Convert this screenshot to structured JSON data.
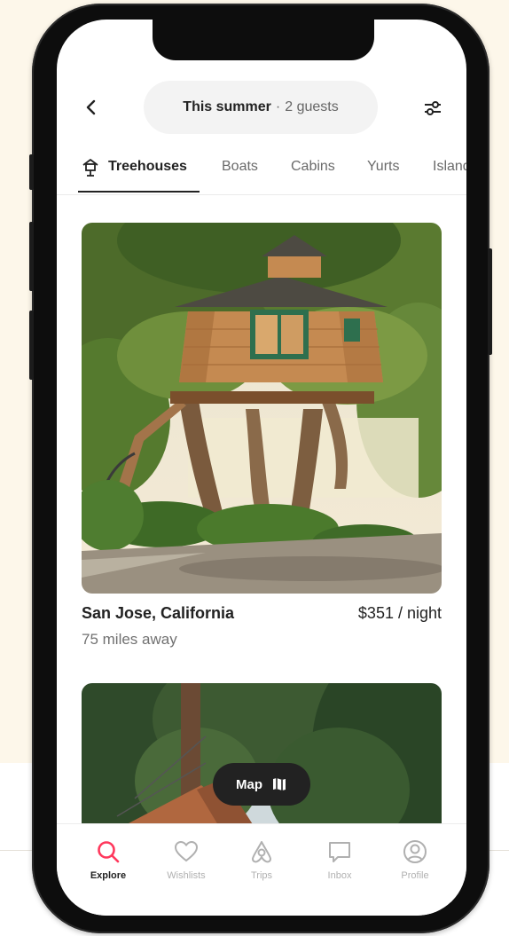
{
  "header": {
    "when": "This summer",
    "separator": "·",
    "guests": "2 guests",
    "back_icon": "chevron-left-icon",
    "filter_icon": "sliders-icon"
  },
  "categories": {
    "active_icon": "treehouse-icon",
    "items": [
      "Treehouses",
      "Boats",
      "Cabins",
      "Yurts",
      "Islands"
    ]
  },
  "listing": {
    "location": "San Jose, California",
    "price": "$351 / night",
    "distance": "75 miles away"
  },
  "map_button": {
    "label": "Map",
    "icon": "map-icon"
  },
  "tabbar": {
    "items": [
      {
        "label": "Explore",
        "icon": "search-icon"
      },
      {
        "label": "Wishlists",
        "icon": "heart-icon"
      },
      {
        "label": "Trips",
        "icon": "airbnb-logo-icon"
      },
      {
        "label": "Inbox",
        "icon": "message-icon"
      },
      {
        "label": "Profile",
        "icon": "user-circle-icon"
      }
    ]
  },
  "colors": {
    "brand": "#ff385c",
    "text": "#222222",
    "muted": "#717171",
    "background": "#fdf7ea"
  }
}
